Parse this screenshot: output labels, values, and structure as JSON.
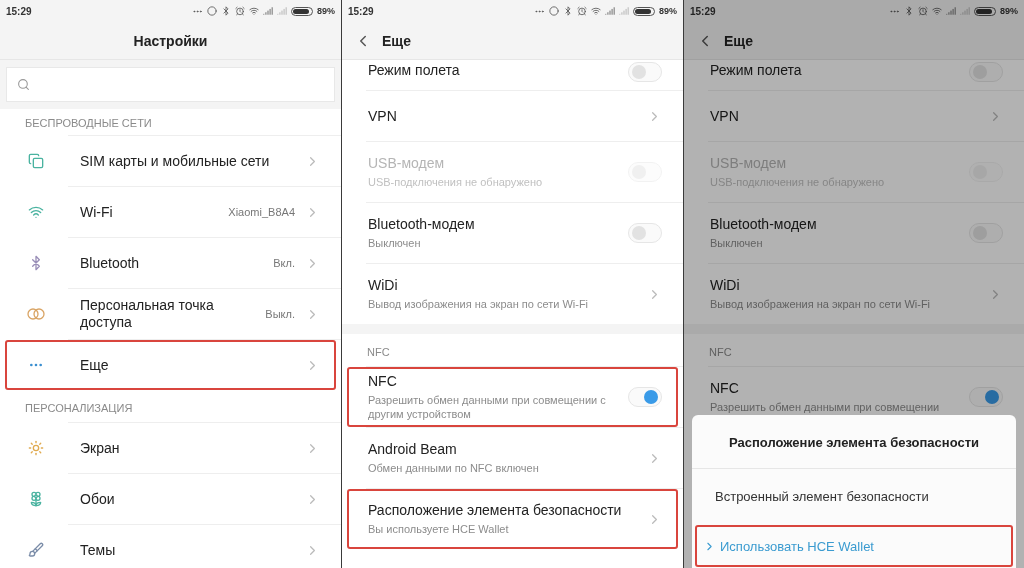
{
  "screens": [
    {
      "kind": "main",
      "status": {
        "time": "15:29",
        "battery": "89%",
        "extra_indicator": true
      },
      "title": "Настройки",
      "back": false,
      "search_field": true,
      "dimmed": false,
      "sections": [
        {
          "header": "БЕСПРОВОДНЫЕ СЕТИ",
          "items": [
            {
              "kind": "link",
              "label": "SIM карты и мобильные сети",
              "highlighted": false
            },
            {
              "kind": "link",
              "label": "Wi-Fi",
              "value": "Xiaomi_B8A4",
              "highlighted": false
            },
            {
              "kind": "link",
              "label": "Bluetooth",
              "value": "Вкл.",
              "highlighted": false
            },
            {
              "kind": "link",
              "label": "Персональная точка доступа",
              "value": "Выкл.",
              "highlighted": false
            },
            {
              "kind": "link",
              "label": "Еще",
              "highlighted": true
            }
          ]
        },
        {
          "header": "ПЕРСОНАЛИЗАЦИЯ",
          "items": [
            {
              "kind": "link",
              "label": "Экран",
              "highlighted": false
            },
            {
              "kind": "link",
              "label": "Обои",
              "highlighted": false
            },
            {
              "kind": "link",
              "label": "Темы",
              "highlighted": false
            }
          ]
        }
      ]
    },
    {
      "kind": "sub",
      "status": {
        "time": "15:29",
        "battery": "89%",
        "extra_indicator": true
      },
      "title": "Еще",
      "back": true,
      "dimmed": false,
      "sections": [
        {
          "items": [
            {
              "kind": "toggle",
              "label": "Режим полета",
              "on": false,
              "disabled": false,
              "clipped": true,
              "highlighted": false
            },
            {
              "kind": "link",
              "label": "VPN",
              "highlighted": false
            },
            {
              "kind": "toggle",
              "label": "USB-модем",
              "subtitle": "USB-подключения не обнаружено",
              "on": false,
              "disabled": true,
              "highlighted": false
            },
            {
              "kind": "toggle",
              "label": "Bluetooth-модем",
              "subtitle": "Выключен",
              "on": false,
              "disabled": false,
              "highlighted": false
            },
            {
              "kind": "link",
              "label": "WiDi",
              "subtitle": "Вывод изображения на экран по сети Wi-Fi",
              "highlighted": false
            }
          ]
        },
        {
          "header": "NFC",
          "items": [
            {
              "kind": "toggle",
              "label": "NFC",
              "subtitle": "Разрешить обмен данными при совмещении с другим устройством",
              "on": true,
              "disabled": false,
              "highlighted": true
            },
            {
              "kind": "link",
              "label": "Android Beam",
              "subtitle": "Обмен данными по NFC включен",
              "highlighted": false
            },
            {
              "kind": "link",
              "label": "Расположение элемента безопасности",
              "subtitle": "Вы используете HCE Wallet",
              "highlighted": true
            }
          ]
        }
      ]
    },
    {
      "kind": "sub",
      "status": {
        "time": "15:29",
        "battery": "89%",
        "extra_indicator": false
      },
      "title": "Еще",
      "back": true,
      "dimmed": true,
      "sections": [
        {
          "items": [
            {
              "kind": "toggle",
              "label": "Режим полета",
              "on": false,
              "disabled": false,
              "clipped": true,
              "highlighted": false
            },
            {
              "kind": "link",
              "label": "VPN",
              "highlighted": false
            },
            {
              "kind": "toggle",
              "label": "USB-модем",
              "subtitle": "USB-подключения не обнаружено",
              "on": false,
              "disabled": true,
              "highlighted": false
            },
            {
              "kind": "toggle",
              "label": "Bluetooth-модем",
              "subtitle": "Выключен",
              "on": false,
              "disabled": false,
              "highlighted": false
            },
            {
              "kind": "link",
              "label": "WiDi",
              "subtitle": "Вывод изображения на экран по сети Wi-Fi",
              "highlighted": false
            }
          ]
        },
        {
          "header": "NFC",
          "items": [
            {
              "kind": "toggle",
              "label": "NFC",
              "subtitle": "Разрешить обмен данными при совмещении",
              "on": true,
              "disabled": false,
              "highlighted": false
            }
          ]
        }
      ],
      "dialog": {
        "title": "Расположение элемента безопасности",
        "options": [
          {
            "label": "Встроенный элемент безопасности",
            "selected": false,
            "highlighted": false
          },
          {
            "label": "Использовать HCE Wallet",
            "selected": true,
            "highlighted": true
          }
        ]
      }
    }
  ]
}
